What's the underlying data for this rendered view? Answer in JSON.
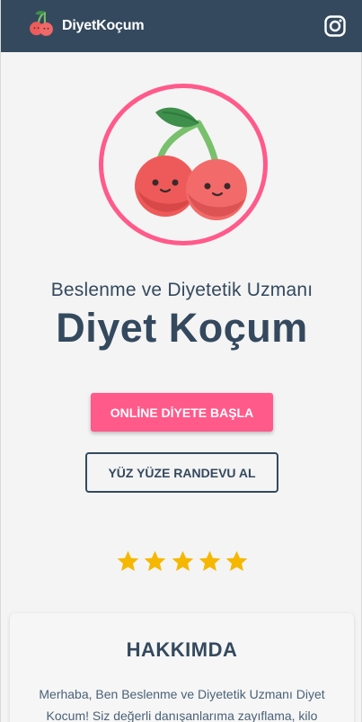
{
  "navbar": {
    "brand": "DiyetKoçum",
    "instagram_icon": "instagram-icon",
    "logo_icon": "cherry-icon",
    "bg_color": "#34495e"
  },
  "hero": {
    "logo_icon": "cherry-icon",
    "subtitle": "Beslenme ve Diyetetik Uzmanı",
    "title": "Diyet Koçum",
    "primary_button": "ONLİNE DİYETE BAŞLA",
    "secondary_button": "YÜZ YÜZE RANDEVU AL",
    "rating": 5,
    "rating_max": 5,
    "accent_color": "#ff5a8a",
    "star_color": "#f5b700"
  },
  "about": {
    "title": "HAKKIMDA",
    "text": "Merhaba, Ben Beslenme ve Diyetetik Uzmanı Diyet Kocum! Siz değerli danışanlarıma zayıflama, kilo"
  }
}
